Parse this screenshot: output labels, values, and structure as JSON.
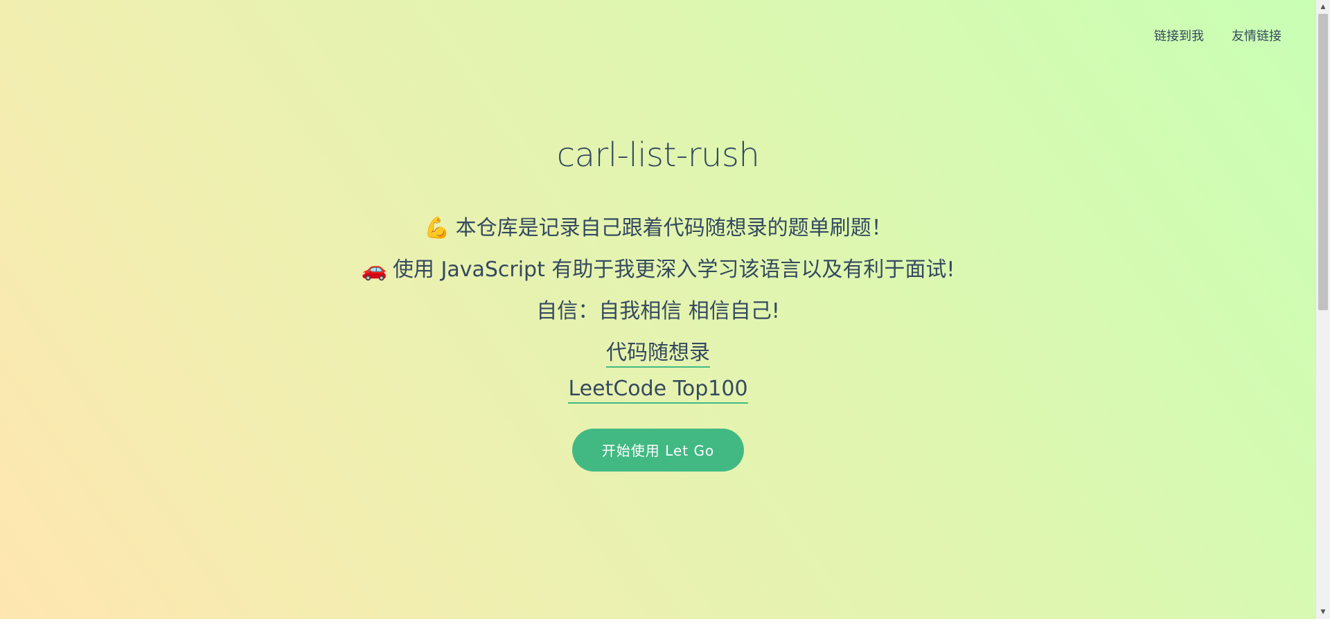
{
  "nav": {
    "items": [
      {
        "label": "链接到我"
      },
      {
        "label": "友情链接"
      }
    ]
  },
  "hero": {
    "title": "carl-list-rush",
    "line1_icon": "💪",
    "line1": "本仓库是记录自己跟着代码随想录的题单刷题！",
    "line2_icon": "🚗",
    "line2": "使用 JavaScript 有助于我更深入学习该语言以及有利于面试!",
    "line3": "自信：自我相信 相信自己!",
    "link1": "代码随想录",
    "link2": "LeetCode Top100",
    "cta_label": "开始使用 Let Go"
  },
  "colors": {
    "accent": "#42b983",
    "text": "#34495e"
  },
  "icons": {
    "scroll_up": "chevron-up-icon",
    "scroll_down": "chevron-down-icon"
  }
}
